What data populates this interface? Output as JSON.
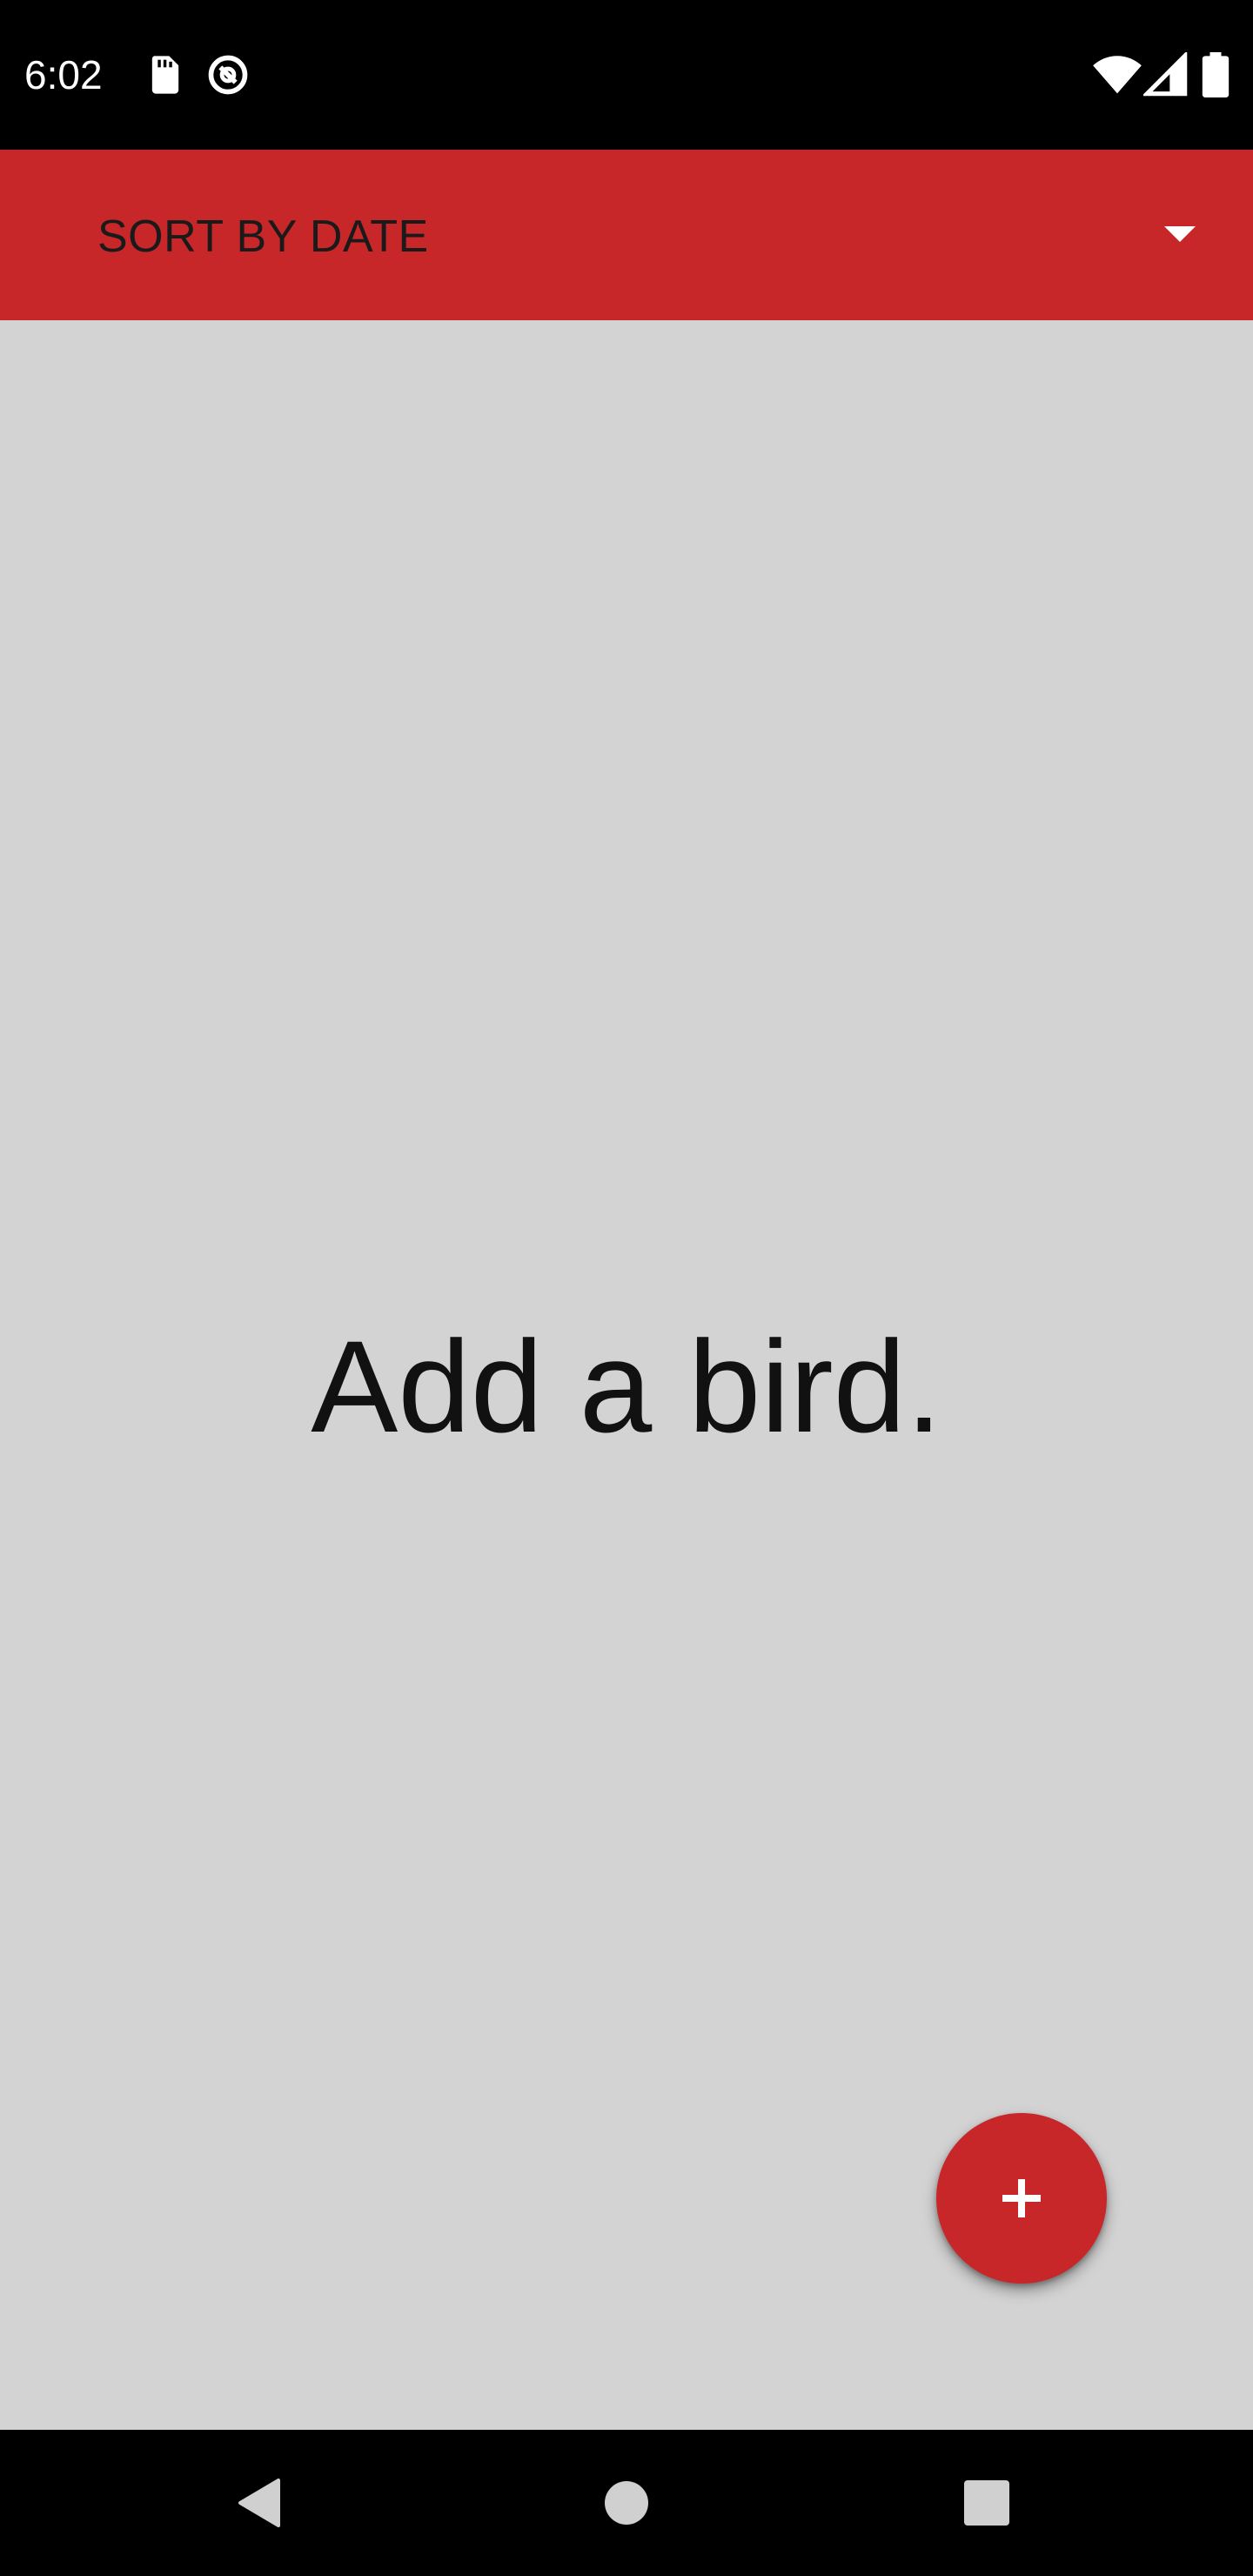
{
  "status_bar": {
    "time": "6:02",
    "icons": [
      "sd-card-icon",
      "sync-icon",
      "wifi-icon",
      "signal-icon",
      "battery-icon"
    ]
  },
  "toolbar": {
    "sort_label": "SORT BY DATE",
    "dropdown_icon": "arrow-drop-down-icon",
    "background_color": "#c8272a"
  },
  "content": {
    "empty_message": "Add a bird.",
    "background_color": "#d3d3d3"
  },
  "fab": {
    "icon": "plus-icon",
    "color": "#c8272a"
  },
  "nav_bar": {
    "buttons": [
      "back-icon",
      "home-icon",
      "recents-icon"
    ]
  }
}
